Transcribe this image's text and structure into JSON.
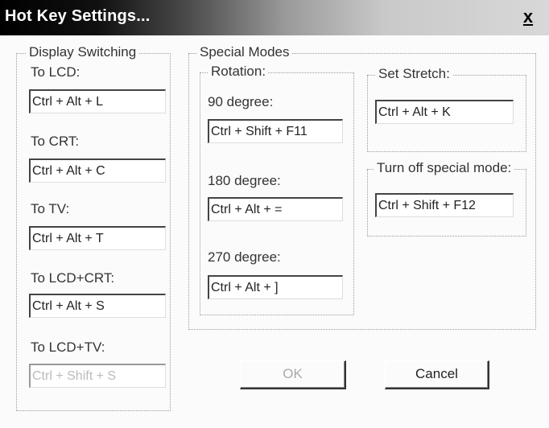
{
  "window": {
    "title": "Hot Key Settings...",
    "close_label": "x"
  },
  "display_switching": {
    "label": "Display Switching",
    "items": [
      {
        "label": "To LCD:",
        "value": "Ctrl + Alt + L"
      },
      {
        "label": "To CRT:",
        "value": "Ctrl + Alt + C"
      },
      {
        "label": "To TV:",
        "value": "Ctrl + Alt + T"
      },
      {
        "label": "To LCD+CRT:",
        "value": "Ctrl + Alt + S"
      },
      {
        "label": "To LCD+TV:",
        "value": "Ctrl + Shift + S"
      }
    ]
  },
  "special_modes": {
    "label": "Special Modes",
    "rotation": {
      "label": "Rotation:",
      "items": [
        {
          "label": "90 degree:",
          "value": "Ctrl + Shift + F11"
        },
        {
          "label": "180 degree:",
          "value": "Ctrl + Alt + ="
        },
        {
          "label": "270 degree:",
          "value": "Ctrl + Alt + ]"
        }
      ]
    },
    "set_stretch": {
      "label": "Set Stretch:",
      "value": "Ctrl + Alt + K"
    },
    "turn_off": {
      "label": "Turn off special mode:",
      "value": "Ctrl + Shift + F12"
    }
  },
  "buttons": {
    "ok": "OK",
    "cancel": "Cancel"
  }
}
